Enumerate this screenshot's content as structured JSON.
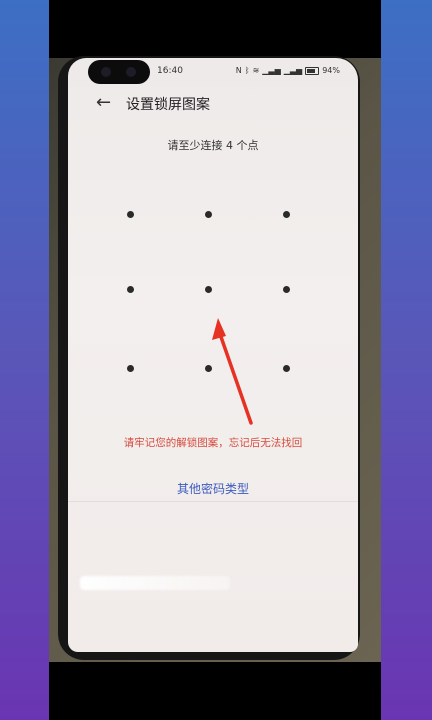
{
  "status_bar": {
    "time": "16:40",
    "battery_text": "94%",
    "icons": [
      "nfc-icon",
      "bluetooth-icon",
      "wifi-icon",
      "signal-icon",
      "battery-icon"
    ]
  },
  "header": {
    "back_icon": "←",
    "title": "设置锁屏图案"
  },
  "instruction": "请至少连接 4 个点",
  "pattern": {
    "rows": 3,
    "cols": 3,
    "dot_color": "#2a2a2a"
  },
  "warning": "请牢记您的解锁图案，忘记后无法找回",
  "other_password_types": "其他密码类型",
  "colors": {
    "warning": "#d64b3e",
    "link": "#3d5bbf",
    "annotation_arrow": "#e53223"
  }
}
